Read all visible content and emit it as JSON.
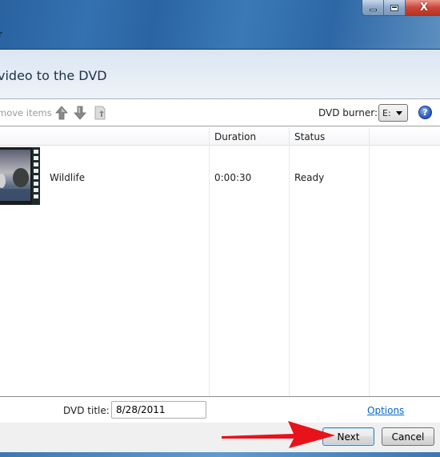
{
  "window": {
    "title_fragment": "r",
    "heading": "video to the DVD",
    "caption_buttons": {
      "minimize_icon": "minimize-icon",
      "maximize_icon": "maximize-icon",
      "close_label": "X"
    }
  },
  "toolbar": {
    "remove_items_label": "move items",
    "move_up_icon": "arrow-up-icon",
    "move_down_icon": "arrow-down-icon",
    "extra_icon": "document-up-icon",
    "burner_label": "DVD burner:",
    "burner_value": "E:",
    "help_label": "?"
  },
  "list": {
    "columns": [
      {
        "label": "Duration"
      },
      {
        "label": "Status"
      }
    ],
    "items": [
      {
        "name": "Wildlife",
        "duration": "0:00:30",
        "status": "Ready",
        "thumbnail": "video-thumbnail"
      }
    ]
  },
  "dvd_title": {
    "label": "DVD title:",
    "value": "8/28/2011"
  },
  "options_link": "Options",
  "buttons": {
    "next": "Next",
    "cancel": "Cancel"
  },
  "colors": {
    "titlebar": "#2b64a3",
    "link": "#0066cc",
    "annotation_arrow": "#e8121a",
    "close_button": "#c8463a"
  }
}
